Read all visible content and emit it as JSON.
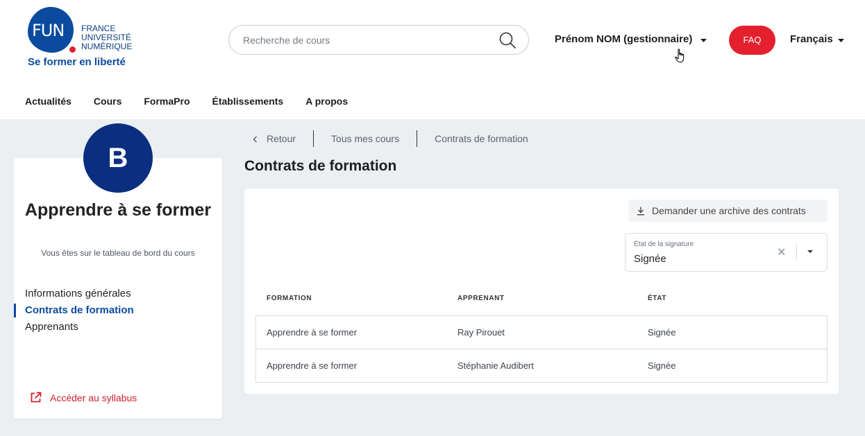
{
  "logo": {
    "mark": "FUN",
    "line1": "France",
    "line2": "Université",
    "line3": "Numérique",
    "tagline": "Se former en liberté"
  },
  "search": {
    "placeholder": "Recherche de cours"
  },
  "user_menu": {
    "label": "Prénom NOM (gestionnaire)"
  },
  "faq": {
    "label": "FAQ"
  },
  "language": {
    "label": "Français"
  },
  "main_nav": [
    "Actualités",
    "Cours",
    "FormaPro",
    "Établissements",
    "A propos"
  ],
  "sidebar": {
    "avatar_letter": "B",
    "course_title": "Apprendre à se former",
    "subtitle": "Vous êtes sur le tableau de bord du cours",
    "items": [
      {
        "label": "Informations générales",
        "active": false
      },
      {
        "label": "Contrats de formation",
        "active": true
      },
      {
        "label": "Apprenants",
        "active": false
      }
    ],
    "syllabus_link": "Accéder au syllabus"
  },
  "breadcrumb": {
    "back": "Retour",
    "items": [
      "Tous mes cours",
      "Contrats de formation"
    ]
  },
  "page_title": "Contrats de formation",
  "archive_button": "Demander une archive des contrats",
  "signature_filter": {
    "label": "État de la signature",
    "value": "Signée"
  },
  "table": {
    "headers": [
      "FORMATION",
      "APPRENANT",
      "ÉTAT"
    ],
    "rows": [
      [
        "Apprendre à se former",
        "Ray Pirouet",
        "Signée"
      ],
      [
        "Apprendre à se former",
        "Stéphanie Audibert",
        "Signée"
      ]
    ]
  },
  "colors": {
    "brand_blue": "#0b4b9f",
    "brand_red": "#e5202e",
    "avatar_blue": "#0b2f80"
  }
}
